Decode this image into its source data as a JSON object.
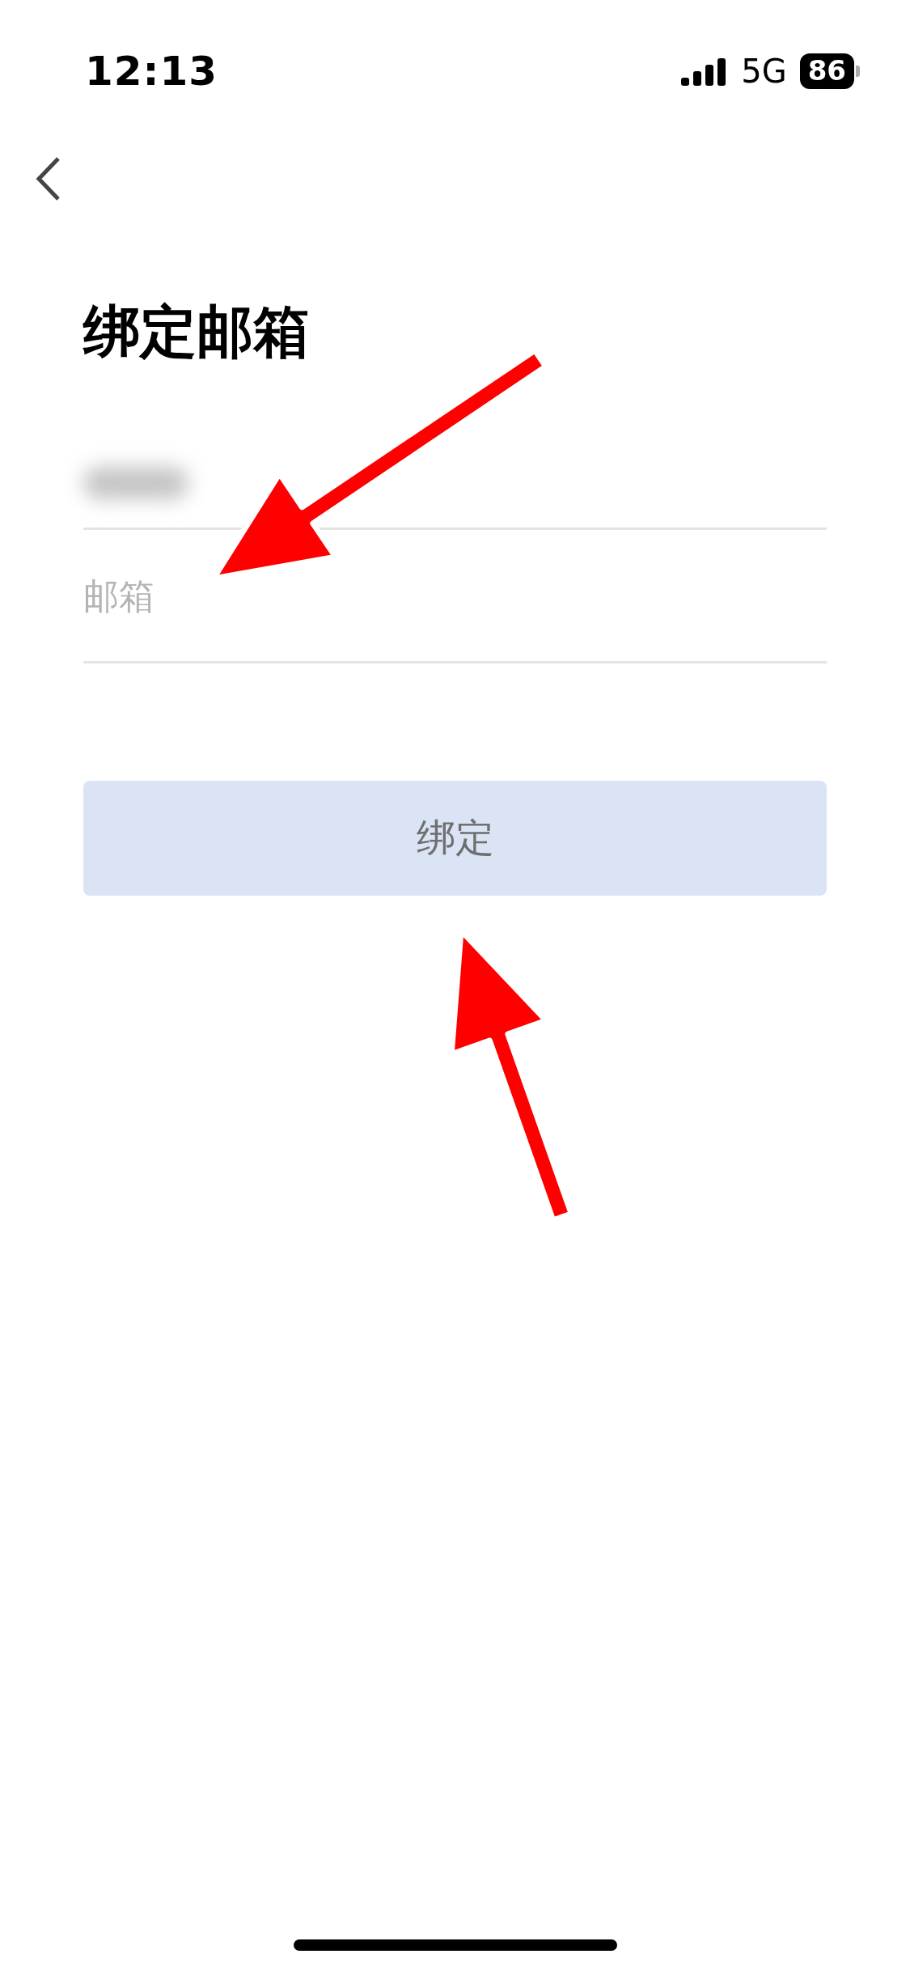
{
  "status_bar": {
    "time": "12:13",
    "network": "5G",
    "battery": "86"
  },
  "title": "绑定邮箱",
  "form": {
    "email_field": {
      "placeholder": "邮箱"
    },
    "submit": {
      "label": "绑定",
      "disabled": true
    }
  }
}
